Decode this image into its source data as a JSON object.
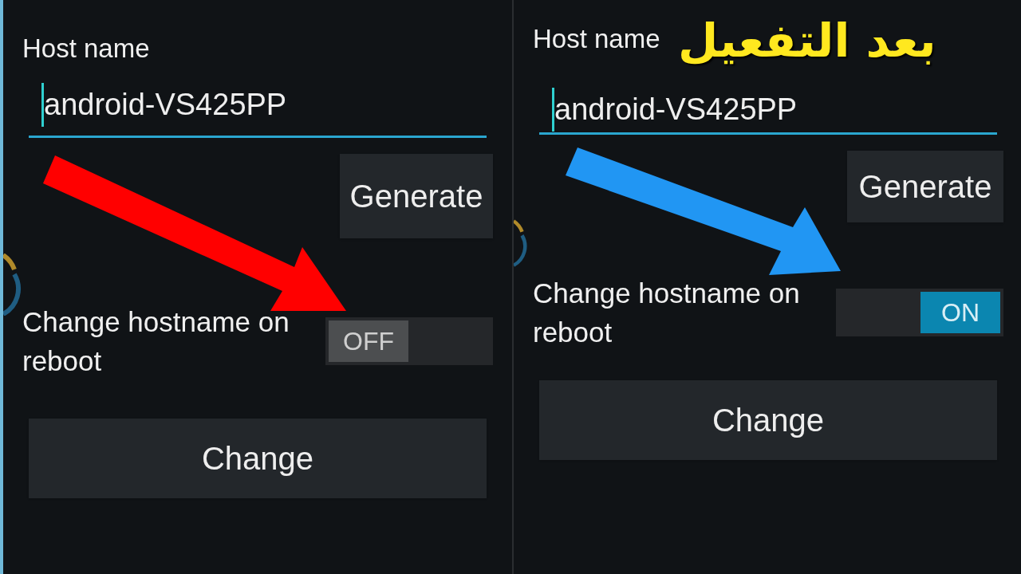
{
  "panels": [
    {
      "host_label": "Host name",
      "host_value": "android-VS425PP",
      "generate": "Generate",
      "toggle_label": "Change hostname on reboot",
      "toggle": {
        "on": false,
        "label": "OFF"
      },
      "change": "Change",
      "color": "#ff0000"
    },
    {
      "host_label": "Host name",
      "host_value": "android-VS425PP",
      "generate": "Generate",
      "toggle_label": "Change hostname on reboot",
      "toggle": {
        "on": true,
        "label": "ON"
      },
      "change": "Change",
      "color": "#2196f3"
    }
  ],
  "overlay_caption": "بعد التفعيل"
}
